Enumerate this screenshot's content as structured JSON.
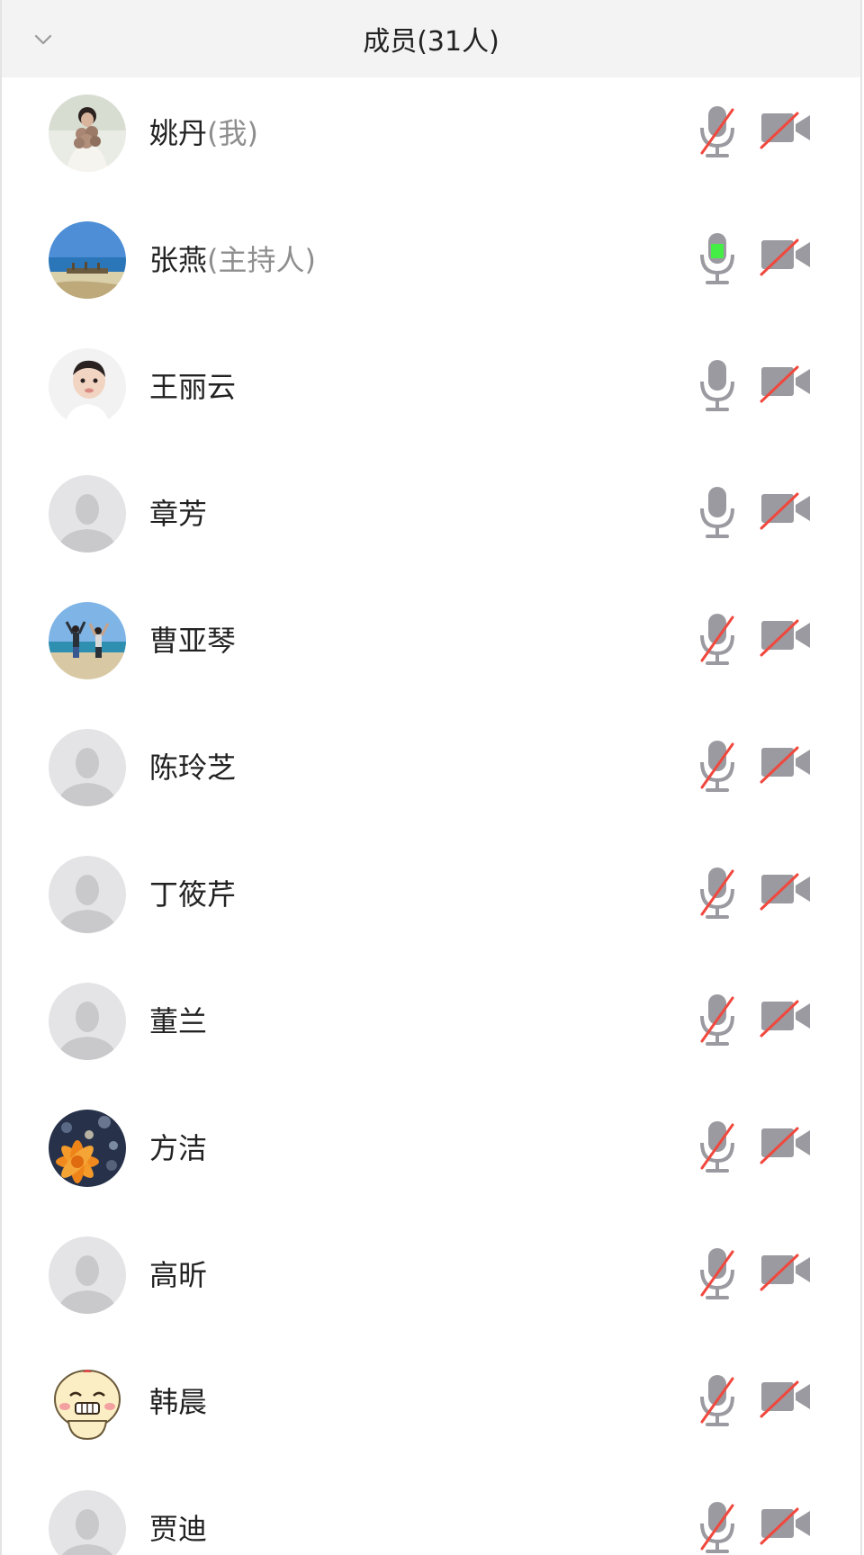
{
  "header": {
    "title": "成员(31人)"
  },
  "members": [
    {
      "name": "姚丹",
      "role": "(我)",
      "avatar": "photo-woman-flowers",
      "mic": "muted",
      "camera": "off"
    },
    {
      "name": "张燕",
      "role": "(主持人)",
      "avatar": "photo-beach",
      "mic": "speaking",
      "camera": "off"
    },
    {
      "name": "王丽云",
      "role": "",
      "avatar": "photo-baby",
      "mic": "on",
      "camera": "off"
    },
    {
      "name": "章芳",
      "role": "",
      "avatar": "default-person",
      "mic": "on",
      "camera": "off"
    },
    {
      "name": "曹亚琴",
      "role": "",
      "avatar": "photo-beach-people",
      "mic": "muted",
      "camera": "off"
    },
    {
      "name": "陈玲芝",
      "role": "",
      "avatar": "default-person",
      "mic": "muted",
      "camera": "off"
    },
    {
      "name": "丁筱芹",
      "role": "",
      "avatar": "default-person",
      "mic": "muted",
      "camera": "off"
    },
    {
      "name": "董兰",
      "role": "",
      "avatar": "default-person",
      "mic": "muted",
      "camera": "off"
    },
    {
      "name": "方洁",
      "role": "",
      "avatar": "photo-orange-flower",
      "mic": "muted",
      "camera": "off"
    },
    {
      "name": "高昕",
      "role": "",
      "avatar": "default-person",
      "mic": "muted",
      "camera": "off"
    },
    {
      "name": "韩晨",
      "role": "",
      "avatar": "cartoon-face",
      "mic": "muted",
      "camera": "off"
    },
    {
      "name": "贾迪",
      "role": "",
      "avatar": "default-person",
      "mic": "muted",
      "camera": "off"
    }
  ],
  "colors": {
    "icon_gray": "#9a9aa0",
    "mute_slash": "#f0483e",
    "speaking": "#44ee44",
    "header_bg": "#f3f3f3"
  }
}
